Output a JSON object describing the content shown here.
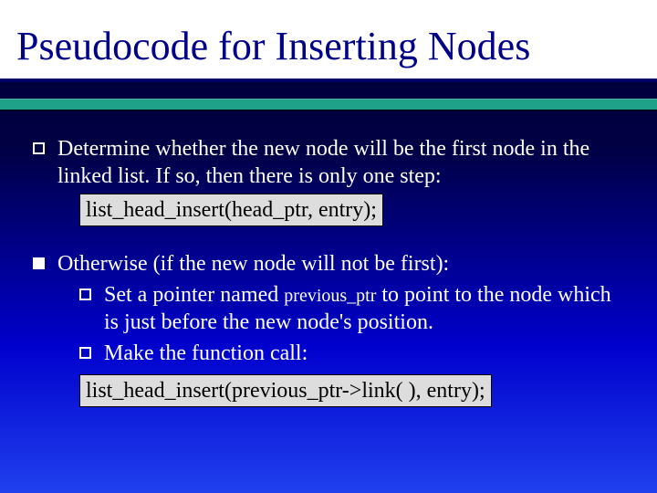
{
  "title": "Pseudocode for Inserting Nodes",
  "items": [
    {
      "text": "Determine whether the new node will be the first node in the linked list.  If so, then there is only one step:",
      "code": "list_head_insert(head_ptr, entry);"
    },
    {
      "text": "Otherwise (if the new node will not be first):",
      "subs": [
        {
          "pre": "Set a pointer named ",
          "mono": "previous_ptr",
          "post": " to point to the node which is just before the new node's position."
        },
        {
          "pre": "Make the function call:",
          "mono": "",
          "post": ""
        }
      ],
      "code": "list_head_insert(previous_ptr->link( ), entry);"
    }
  ]
}
